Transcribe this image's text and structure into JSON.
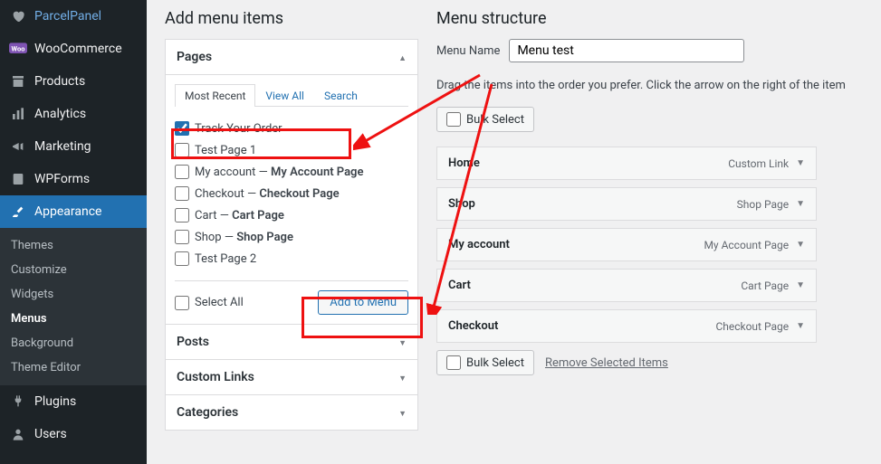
{
  "sidebar": {
    "items": [
      {
        "label": "ParcelPanel",
        "icon": "heart"
      },
      {
        "label": "WooCommerce",
        "icon": "woo"
      },
      {
        "label": "Products",
        "icon": "archive"
      },
      {
        "label": "Analytics",
        "icon": "bars"
      },
      {
        "label": "Marketing",
        "icon": "mega"
      },
      {
        "label": "WPForms",
        "icon": "forms"
      },
      {
        "label": "Appearance",
        "icon": "brush"
      },
      {
        "label": "Plugins",
        "icon": "plug"
      },
      {
        "label": "Users",
        "icon": "user"
      }
    ],
    "submenu": [
      {
        "label": "Themes"
      },
      {
        "label": "Customize"
      },
      {
        "label": "Widgets"
      },
      {
        "label": "Menus"
      },
      {
        "label": "Background"
      },
      {
        "label": "Theme Editor"
      }
    ]
  },
  "addMenu": {
    "heading": "Add menu items",
    "pages": {
      "title": "Pages",
      "tabs": [
        "Most Recent",
        "View All",
        "Search"
      ],
      "items": [
        {
          "label": "Track Your Order",
          "checked": true
        },
        {
          "label": "Test Page 1"
        },
        {
          "label": "My account",
          "suffix": "My Account Page"
        },
        {
          "label": "Checkout",
          "suffix": "Checkout Page"
        },
        {
          "label": "Cart",
          "suffix": "Cart Page"
        },
        {
          "label": "Shop",
          "suffix": "Shop Page"
        },
        {
          "label": "Test Page 2"
        }
      ],
      "selectAll": "Select All",
      "addBtn": "Add to Menu"
    },
    "others": [
      "Posts",
      "Custom Links",
      "Categories"
    ]
  },
  "structure": {
    "heading": "Menu structure",
    "menuNameLabel": "Menu Name",
    "menuNameValue": "Menu test",
    "instruction": "Drag the items into the order you prefer. Click the arrow on the right of the item",
    "bulkSelect": "Bulk Select",
    "items": [
      {
        "title": "Home",
        "type": "Custom Link"
      },
      {
        "title": "Shop",
        "type": "Shop Page"
      },
      {
        "title": "My account",
        "type": "My Account Page"
      },
      {
        "title": "Cart",
        "type": "Cart Page"
      },
      {
        "title": "Checkout",
        "type": "Checkout Page"
      }
    ],
    "removeLink": "Remove Selected Items"
  }
}
